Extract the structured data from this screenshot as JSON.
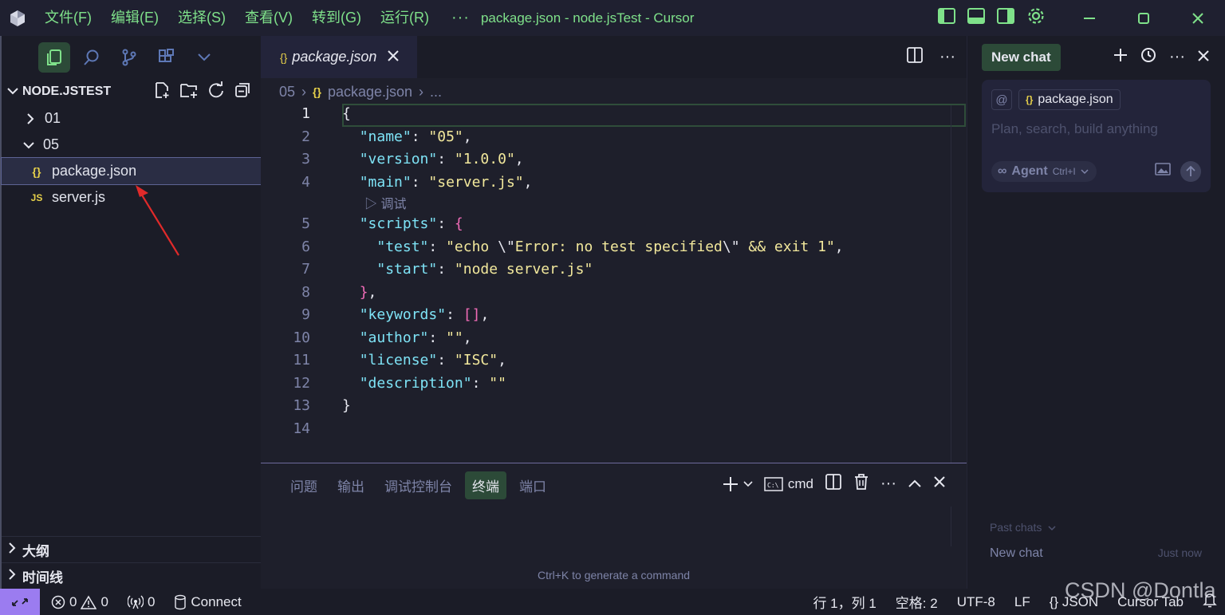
{
  "titlebar": {
    "menus": [
      "文件(F)",
      "编辑(E)",
      "选择(S)",
      "查看(V)",
      "转到(G)",
      "运行(R)"
    ],
    "more": "···",
    "window_title": "package.json - node.jsTest - Cursor"
  },
  "explorer": {
    "title": "NODE.JSTEST",
    "tree": [
      {
        "label": "01",
        "type": "folder",
        "expanded": false
      },
      {
        "label": "05",
        "type": "folder",
        "expanded": true
      },
      {
        "label": "package.json",
        "type": "json",
        "icon": "{}",
        "selected": true
      },
      {
        "label": "server.js",
        "type": "js",
        "icon": "JS",
        "selected": false
      }
    ],
    "sections": [
      "大纲",
      "时间线"
    ]
  },
  "editor": {
    "tab_label": "package.json",
    "breadcrumb": [
      "05",
      "package.json",
      "..."
    ],
    "codelens": "调试",
    "lines": [
      "1",
      "2",
      "3",
      "4",
      "5",
      "6",
      "7",
      "8",
      "9",
      "10",
      "11",
      "12",
      "13",
      "14"
    ],
    "code": {
      "l1": "{",
      "name_key": "\"name\"",
      "name_val": "\"05\"",
      "version_key": "\"version\"",
      "version_val": "\"1.0.0\"",
      "main_key": "\"main\"",
      "main_val": "\"server.js\"",
      "scripts_key": "\"scripts\"",
      "test_key": "\"test\"",
      "test_val_a": "\"echo ",
      "test_esc1": "\\\"",
      "test_val_b": "Error: no test specified",
      "test_esc2": "\\\"",
      "test_val_c": " && exit 1\"",
      "start_key": "\"start\"",
      "start_val": "\"node server.js\"",
      "keywords_key": "\"keywords\"",
      "keywords_val": "[]",
      "author_key": "\"author\"",
      "author_val": "\"\"",
      "license_key": "\"license\"",
      "license_val": "\"ISC\"",
      "description_key": "\"description\"",
      "description_val": "\"\"",
      "l13": "}"
    }
  },
  "panel": {
    "tabs": [
      "问题",
      "输出",
      "调试控制台",
      "终端",
      "端口"
    ],
    "active_tab": "终端",
    "shell": "cmd",
    "hint": "Ctrl+K to generate a command"
  },
  "chat": {
    "new_chat_label": "New chat",
    "context_at": "@",
    "context_file": "package.json",
    "placeholder": "Plan, search, build anything",
    "agent_label": "Agent",
    "agent_shortcut": "Ctrl+I",
    "past_chats_label": "Past chats",
    "past_items": [
      {
        "name": "New chat",
        "time": "Just now"
      }
    ]
  },
  "status": {
    "errors": "0",
    "warnings": "0",
    "ports": "0",
    "connect": "Connect",
    "position": "行 1，列 1",
    "spaces": "空格: 2",
    "encoding": "UTF-8",
    "eol": "LF",
    "language": "JSON",
    "cursor_tab": "Cursor Tab"
  },
  "watermark": "CSDN @Dontla",
  "colors": {
    "accent_green": "#7fe18a",
    "selection_green": "#2c4a38",
    "remote_purple": "#9b7cf0",
    "json_key": "#7ee3f6",
    "json_string": "#f2e89c",
    "bracket_pink": "#f06bb7"
  }
}
